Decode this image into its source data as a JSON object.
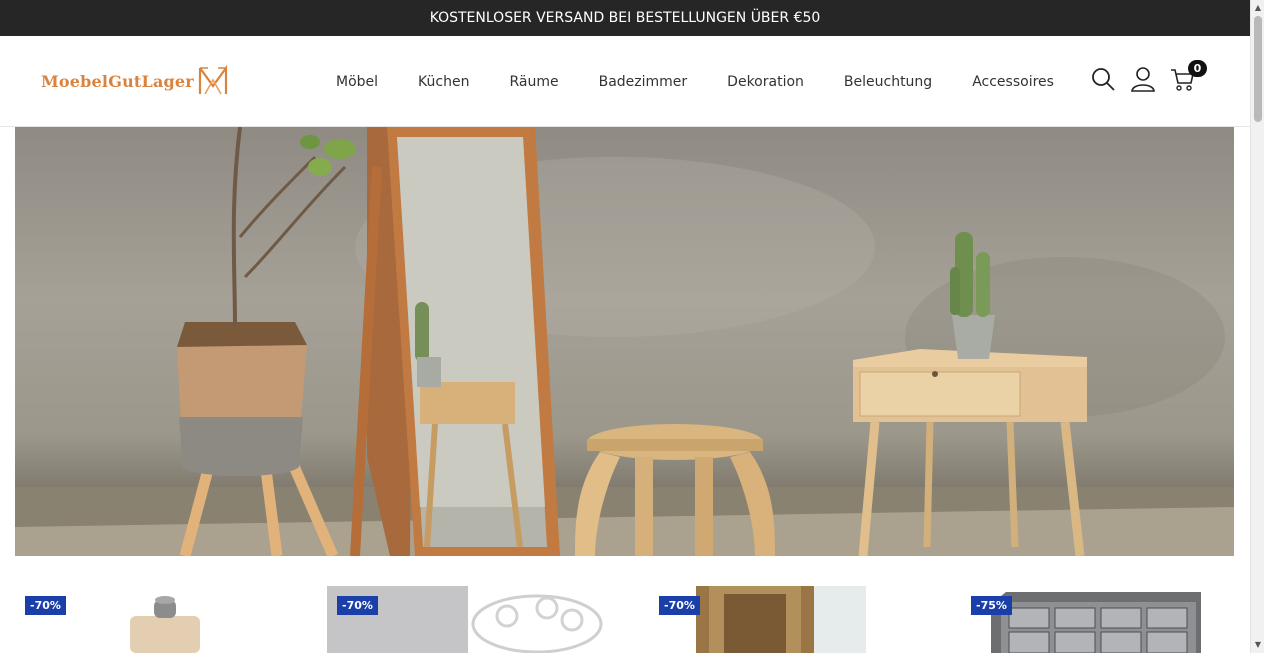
{
  "announcement": "KOSTENLOSER VERSAND BEI BESTELLUNGEN ÜBER €50",
  "brand": {
    "name": "MoebelGutLager",
    "color": "#d9833f"
  },
  "nav": [
    {
      "label": "Möbel"
    },
    {
      "label": "Küchen"
    },
    {
      "label": "Räume"
    },
    {
      "label": "Badezimmer"
    },
    {
      "label": "Dekoration"
    },
    {
      "label": "Beleuchtung"
    },
    {
      "label": "Accessoires"
    }
  ],
  "header_icons": {
    "search": "search-icon",
    "account": "user-icon",
    "cart": "cart-icon",
    "cart_count": "0"
  },
  "products": [
    {
      "discount": "-70%"
    },
    {
      "discount": "-70%"
    },
    {
      "discount": "-70%"
    },
    {
      "discount": "-75%"
    }
  ],
  "colors": {
    "topbar": "#262626",
    "badge": "#1b3fa8"
  }
}
